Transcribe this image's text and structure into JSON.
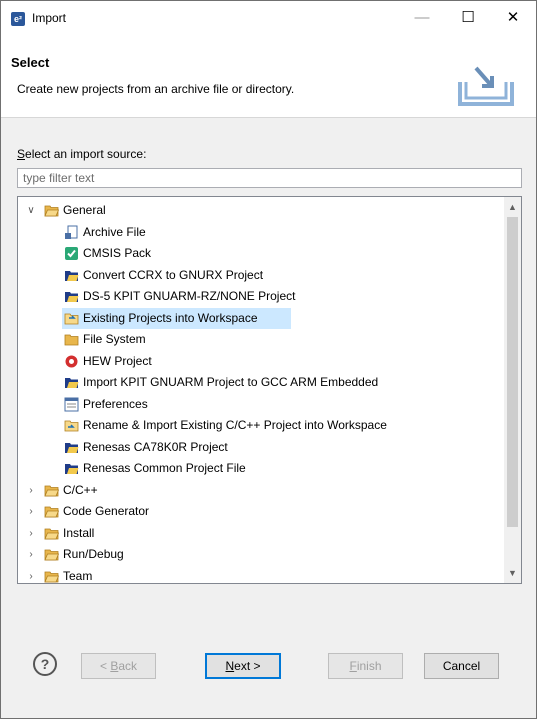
{
  "window": {
    "title": "Import",
    "app_icon": "e²"
  },
  "header": {
    "title": "Select",
    "description": "Create new projects from an archive file or directory."
  },
  "source": {
    "label_underlined": "S",
    "label_rest": "elect an import source:",
    "filter_placeholder": "type filter text"
  },
  "tree": {
    "general_label": "General",
    "general_children": [
      {
        "label": "Archive File",
        "icon": "archive-file-icon"
      },
      {
        "label": "CMSIS Pack",
        "icon": "cmsis-pack-icon"
      },
      {
        "label": "Convert CCRX to GNURX Project",
        "icon": "project-import-icon"
      },
      {
        "label": "DS-5 KPIT GNUARM-RZ/NONE Project",
        "icon": "project-import-icon"
      },
      {
        "label": "Existing Projects into Workspace",
        "icon": "existing-projects-icon"
      },
      {
        "label": "File System",
        "icon": "folder-icon"
      },
      {
        "label": "HEW Project",
        "icon": "hew-icon"
      },
      {
        "label": "Import KPIT GNUARM Project to GCC ARM Embedded",
        "icon": "project-import-icon"
      },
      {
        "label": "Preferences",
        "icon": "preferences-icon"
      },
      {
        "label": "Rename & Import Existing C/C++ Project into Workspace",
        "icon": "rename-import-icon"
      },
      {
        "label": "Renesas CA78K0R Project",
        "icon": "project-import-icon"
      },
      {
        "label": "Renesas Common Project File",
        "icon": "project-import-icon"
      }
    ],
    "categories": [
      {
        "label": "C/C++"
      },
      {
        "label": "Code Generator"
      },
      {
        "label": "Install"
      },
      {
        "label": "Run/Debug"
      },
      {
        "label": "Team"
      }
    ],
    "selected_label": "Existing Projects into Workspace"
  },
  "buttons": {
    "help": "?",
    "back_u": "B",
    "back_pre": "< ",
    "back_post": "ack",
    "next_u": "N",
    "next_post": "ext >",
    "finish_u": "F",
    "finish_post": "inish",
    "cancel": "Cancel"
  },
  "colors": {
    "selection": "#cce8ff",
    "folder": "#e8b64c",
    "accent": "#0078d7"
  }
}
